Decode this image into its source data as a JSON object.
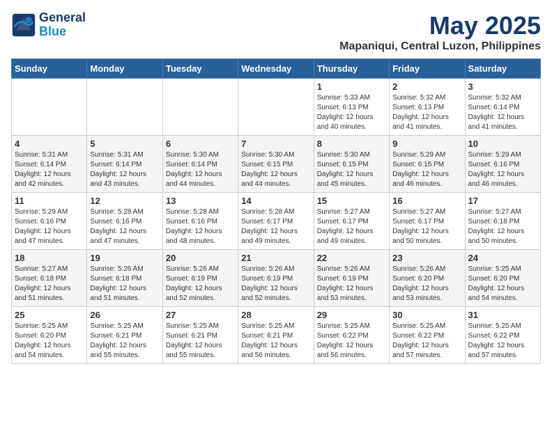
{
  "header": {
    "logo_line1": "General",
    "logo_line2": "Blue",
    "month": "May 2025",
    "location": "Mapaniqui, Central Luzon, Philippines"
  },
  "weekdays": [
    "Sunday",
    "Monday",
    "Tuesday",
    "Wednesday",
    "Thursday",
    "Friday",
    "Saturday"
  ],
  "weeks": [
    [
      {
        "day": "",
        "info": ""
      },
      {
        "day": "",
        "info": ""
      },
      {
        "day": "",
        "info": ""
      },
      {
        "day": "",
        "info": ""
      },
      {
        "day": "1",
        "info": "Sunrise: 5:33 AM\nSunset: 6:13 PM\nDaylight: 12 hours\nand 40 minutes."
      },
      {
        "day": "2",
        "info": "Sunrise: 5:32 AM\nSunset: 6:13 PM\nDaylight: 12 hours\nand 41 minutes."
      },
      {
        "day": "3",
        "info": "Sunrise: 5:32 AM\nSunset: 6:14 PM\nDaylight: 12 hours\nand 41 minutes."
      }
    ],
    [
      {
        "day": "4",
        "info": "Sunrise: 5:31 AM\nSunset: 6:14 PM\nDaylight: 12 hours\nand 42 minutes."
      },
      {
        "day": "5",
        "info": "Sunrise: 5:31 AM\nSunset: 6:14 PM\nDaylight: 12 hours\nand 43 minutes."
      },
      {
        "day": "6",
        "info": "Sunrise: 5:30 AM\nSunset: 6:14 PM\nDaylight: 12 hours\nand 44 minutes."
      },
      {
        "day": "7",
        "info": "Sunrise: 5:30 AM\nSunset: 6:15 PM\nDaylight: 12 hours\nand 44 minutes."
      },
      {
        "day": "8",
        "info": "Sunrise: 5:30 AM\nSunset: 6:15 PM\nDaylight: 12 hours\nand 45 minutes."
      },
      {
        "day": "9",
        "info": "Sunrise: 5:29 AM\nSunset: 6:15 PM\nDaylight: 12 hours\nand 46 minutes."
      },
      {
        "day": "10",
        "info": "Sunrise: 5:29 AM\nSunset: 6:16 PM\nDaylight: 12 hours\nand 46 minutes."
      }
    ],
    [
      {
        "day": "11",
        "info": "Sunrise: 5:29 AM\nSunset: 6:16 PM\nDaylight: 12 hours\nand 47 minutes."
      },
      {
        "day": "12",
        "info": "Sunrise: 5:28 AM\nSunset: 6:16 PM\nDaylight: 12 hours\nand 47 minutes."
      },
      {
        "day": "13",
        "info": "Sunrise: 5:28 AM\nSunset: 6:16 PM\nDaylight: 12 hours\nand 48 minutes."
      },
      {
        "day": "14",
        "info": "Sunrise: 5:28 AM\nSunset: 6:17 PM\nDaylight: 12 hours\nand 49 minutes."
      },
      {
        "day": "15",
        "info": "Sunrise: 5:27 AM\nSunset: 6:17 PM\nDaylight: 12 hours\nand 49 minutes."
      },
      {
        "day": "16",
        "info": "Sunrise: 5:27 AM\nSunset: 6:17 PM\nDaylight: 12 hours\nand 50 minutes."
      },
      {
        "day": "17",
        "info": "Sunrise: 5:27 AM\nSunset: 6:18 PM\nDaylight: 12 hours\nand 50 minutes."
      }
    ],
    [
      {
        "day": "18",
        "info": "Sunrise: 5:27 AM\nSunset: 6:18 PM\nDaylight: 12 hours\nand 51 minutes."
      },
      {
        "day": "19",
        "info": "Sunrise: 5:26 AM\nSunset: 6:18 PM\nDaylight: 12 hours\nand 51 minutes."
      },
      {
        "day": "20",
        "info": "Sunrise: 5:26 AM\nSunset: 6:19 PM\nDaylight: 12 hours\nand 52 minutes."
      },
      {
        "day": "21",
        "info": "Sunrise: 5:26 AM\nSunset: 6:19 PM\nDaylight: 12 hours\nand 52 minutes."
      },
      {
        "day": "22",
        "info": "Sunrise: 5:26 AM\nSunset: 6:19 PM\nDaylight: 12 hours\nand 53 minutes."
      },
      {
        "day": "23",
        "info": "Sunrise: 5:26 AM\nSunset: 6:20 PM\nDaylight: 12 hours\nand 53 minutes."
      },
      {
        "day": "24",
        "info": "Sunrise: 5:25 AM\nSunset: 6:20 PM\nDaylight: 12 hours\nand 54 minutes."
      }
    ],
    [
      {
        "day": "25",
        "info": "Sunrise: 5:25 AM\nSunset: 6:20 PM\nDaylight: 12 hours\nand 54 minutes."
      },
      {
        "day": "26",
        "info": "Sunrise: 5:25 AM\nSunset: 6:21 PM\nDaylight: 12 hours\nand 55 minutes."
      },
      {
        "day": "27",
        "info": "Sunrise: 5:25 AM\nSunset: 6:21 PM\nDaylight: 12 hours\nand 55 minutes."
      },
      {
        "day": "28",
        "info": "Sunrise: 5:25 AM\nSunset: 6:21 PM\nDaylight: 12 hours\nand 56 minutes."
      },
      {
        "day": "29",
        "info": "Sunrise: 5:25 AM\nSunset: 6:22 PM\nDaylight: 12 hours\nand 56 minutes."
      },
      {
        "day": "30",
        "info": "Sunrise: 5:25 AM\nSunset: 6:22 PM\nDaylight: 12 hours\nand 57 minutes."
      },
      {
        "day": "31",
        "info": "Sunrise: 5:25 AM\nSunset: 6:22 PM\nDaylight: 12 hours\nand 57 minutes."
      }
    ]
  ]
}
